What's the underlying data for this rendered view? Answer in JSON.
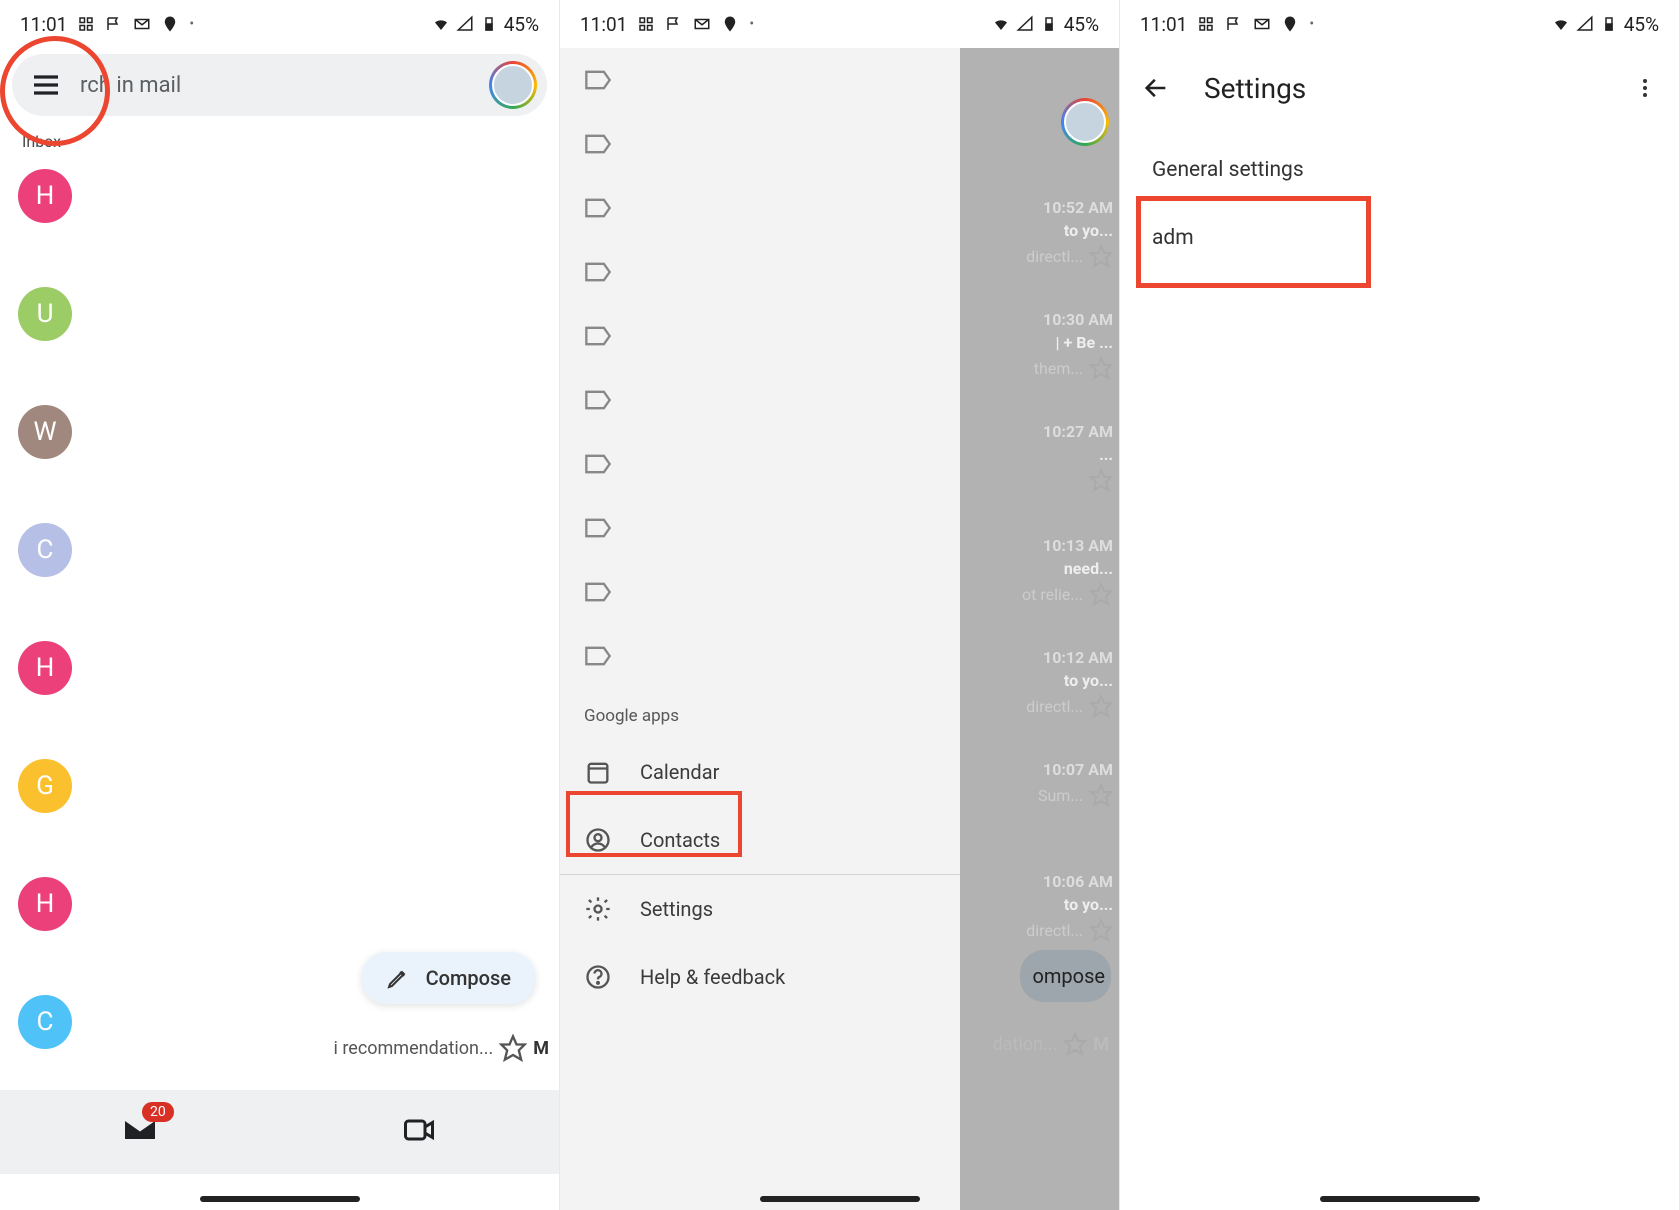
{
  "statusbar": {
    "time": "11:01",
    "battery": "45%"
  },
  "panel1": {
    "search_placeholder": "rch in mail",
    "inbox_label": "Inbox",
    "threads": [
      {
        "letter": "H",
        "color": "#ec407a"
      },
      {
        "letter": "U",
        "color": "#9ccc65"
      },
      {
        "letter": "W",
        "color": "#a1887f"
      },
      {
        "letter": "C",
        "color": "#b6bfe5"
      },
      {
        "letter": "H",
        "color": "#ec407a"
      },
      {
        "letter": "G",
        "color": "#fbc02d"
      },
      {
        "letter": "H",
        "color": "#ec407a"
      },
      {
        "letter": "C",
        "color": "#4fc3f7"
      }
    ],
    "compose_label": "Compose",
    "snippet": "i recommendation...",
    "snippet_letter": "M",
    "badge_count": "20"
  },
  "panel2": {
    "drawer": {
      "section_title": "Google apps",
      "items": {
        "calendar": "Calendar",
        "contacts": "Contacts",
        "settings": "Settings",
        "help": "Help & feedback"
      }
    },
    "peek": [
      {
        "time": "10:52 AM",
        "title": "to yo...",
        "sub": "directl..."
      },
      {
        "time": "10:30 AM",
        "title": "| + Be ...",
        "sub": "them..."
      },
      {
        "time": "10:27 AM",
        "title": "...",
        "sub": ""
      },
      {
        "time": "10:13 AM",
        "title": "need...",
        "sub": "ot relie..."
      },
      {
        "time": "10:12 AM",
        "title": "to yo...",
        "sub": "directl..."
      },
      {
        "time": "10:07 AM",
        "title": "",
        "sub": "Sum..."
      },
      {
        "time": "10:06 AM",
        "title": "to yo...",
        "sub": "directl..."
      }
    ],
    "peek_compose": "ompose",
    "peek_bottom": "dation...",
    "peek_letter": "M"
  },
  "panel3": {
    "header_title": "Settings",
    "general_label": "General settings",
    "account_label": "adm"
  }
}
